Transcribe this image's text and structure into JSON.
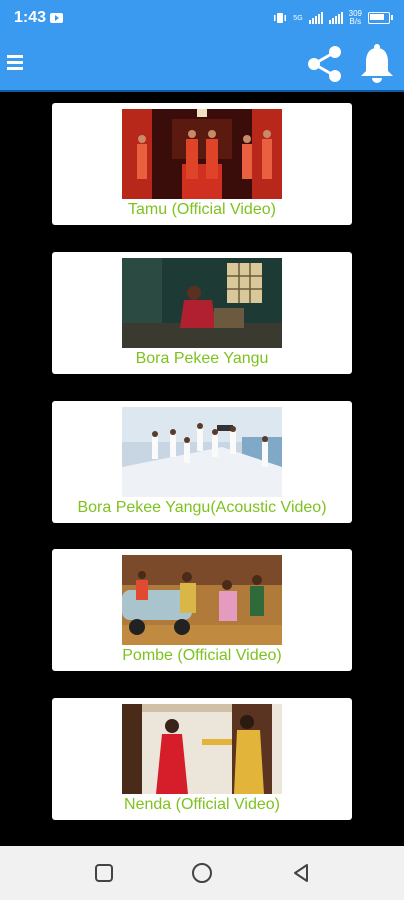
{
  "status_bar": {
    "time": "1:43",
    "net_speed_top": "309",
    "net_speed_bottom": "B/s",
    "signal_label": "5G"
  },
  "app_bar": {
    "menu_icon": "hamburger-menu-icon",
    "share_icon": "share-icon",
    "bell_icon": "notification-bell-icon"
  },
  "videos": [
    {
      "title": "Tamu (Official Video)"
    },
    {
      "title": "Bora Pekee Yangu"
    },
    {
      "title": "Bora Pekee Yangu(Acoustic Video)"
    },
    {
      "title": "Pombe (Official Video)"
    },
    {
      "title": "Nenda (Official Video)"
    }
  ],
  "colors": {
    "app_bar": "#3a9aef",
    "title_text": "#7ec21f",
    "background": "#000000",
    "card": "#ffffff",
    "nav_bar": "#f1f1f1"
  },
  "nav_bar": {
    "recents_icon": "square-recents-icon",
    "home_icon": "circle-home-icon",
    "back_icon": "triangle-back-icon"
  }
}
